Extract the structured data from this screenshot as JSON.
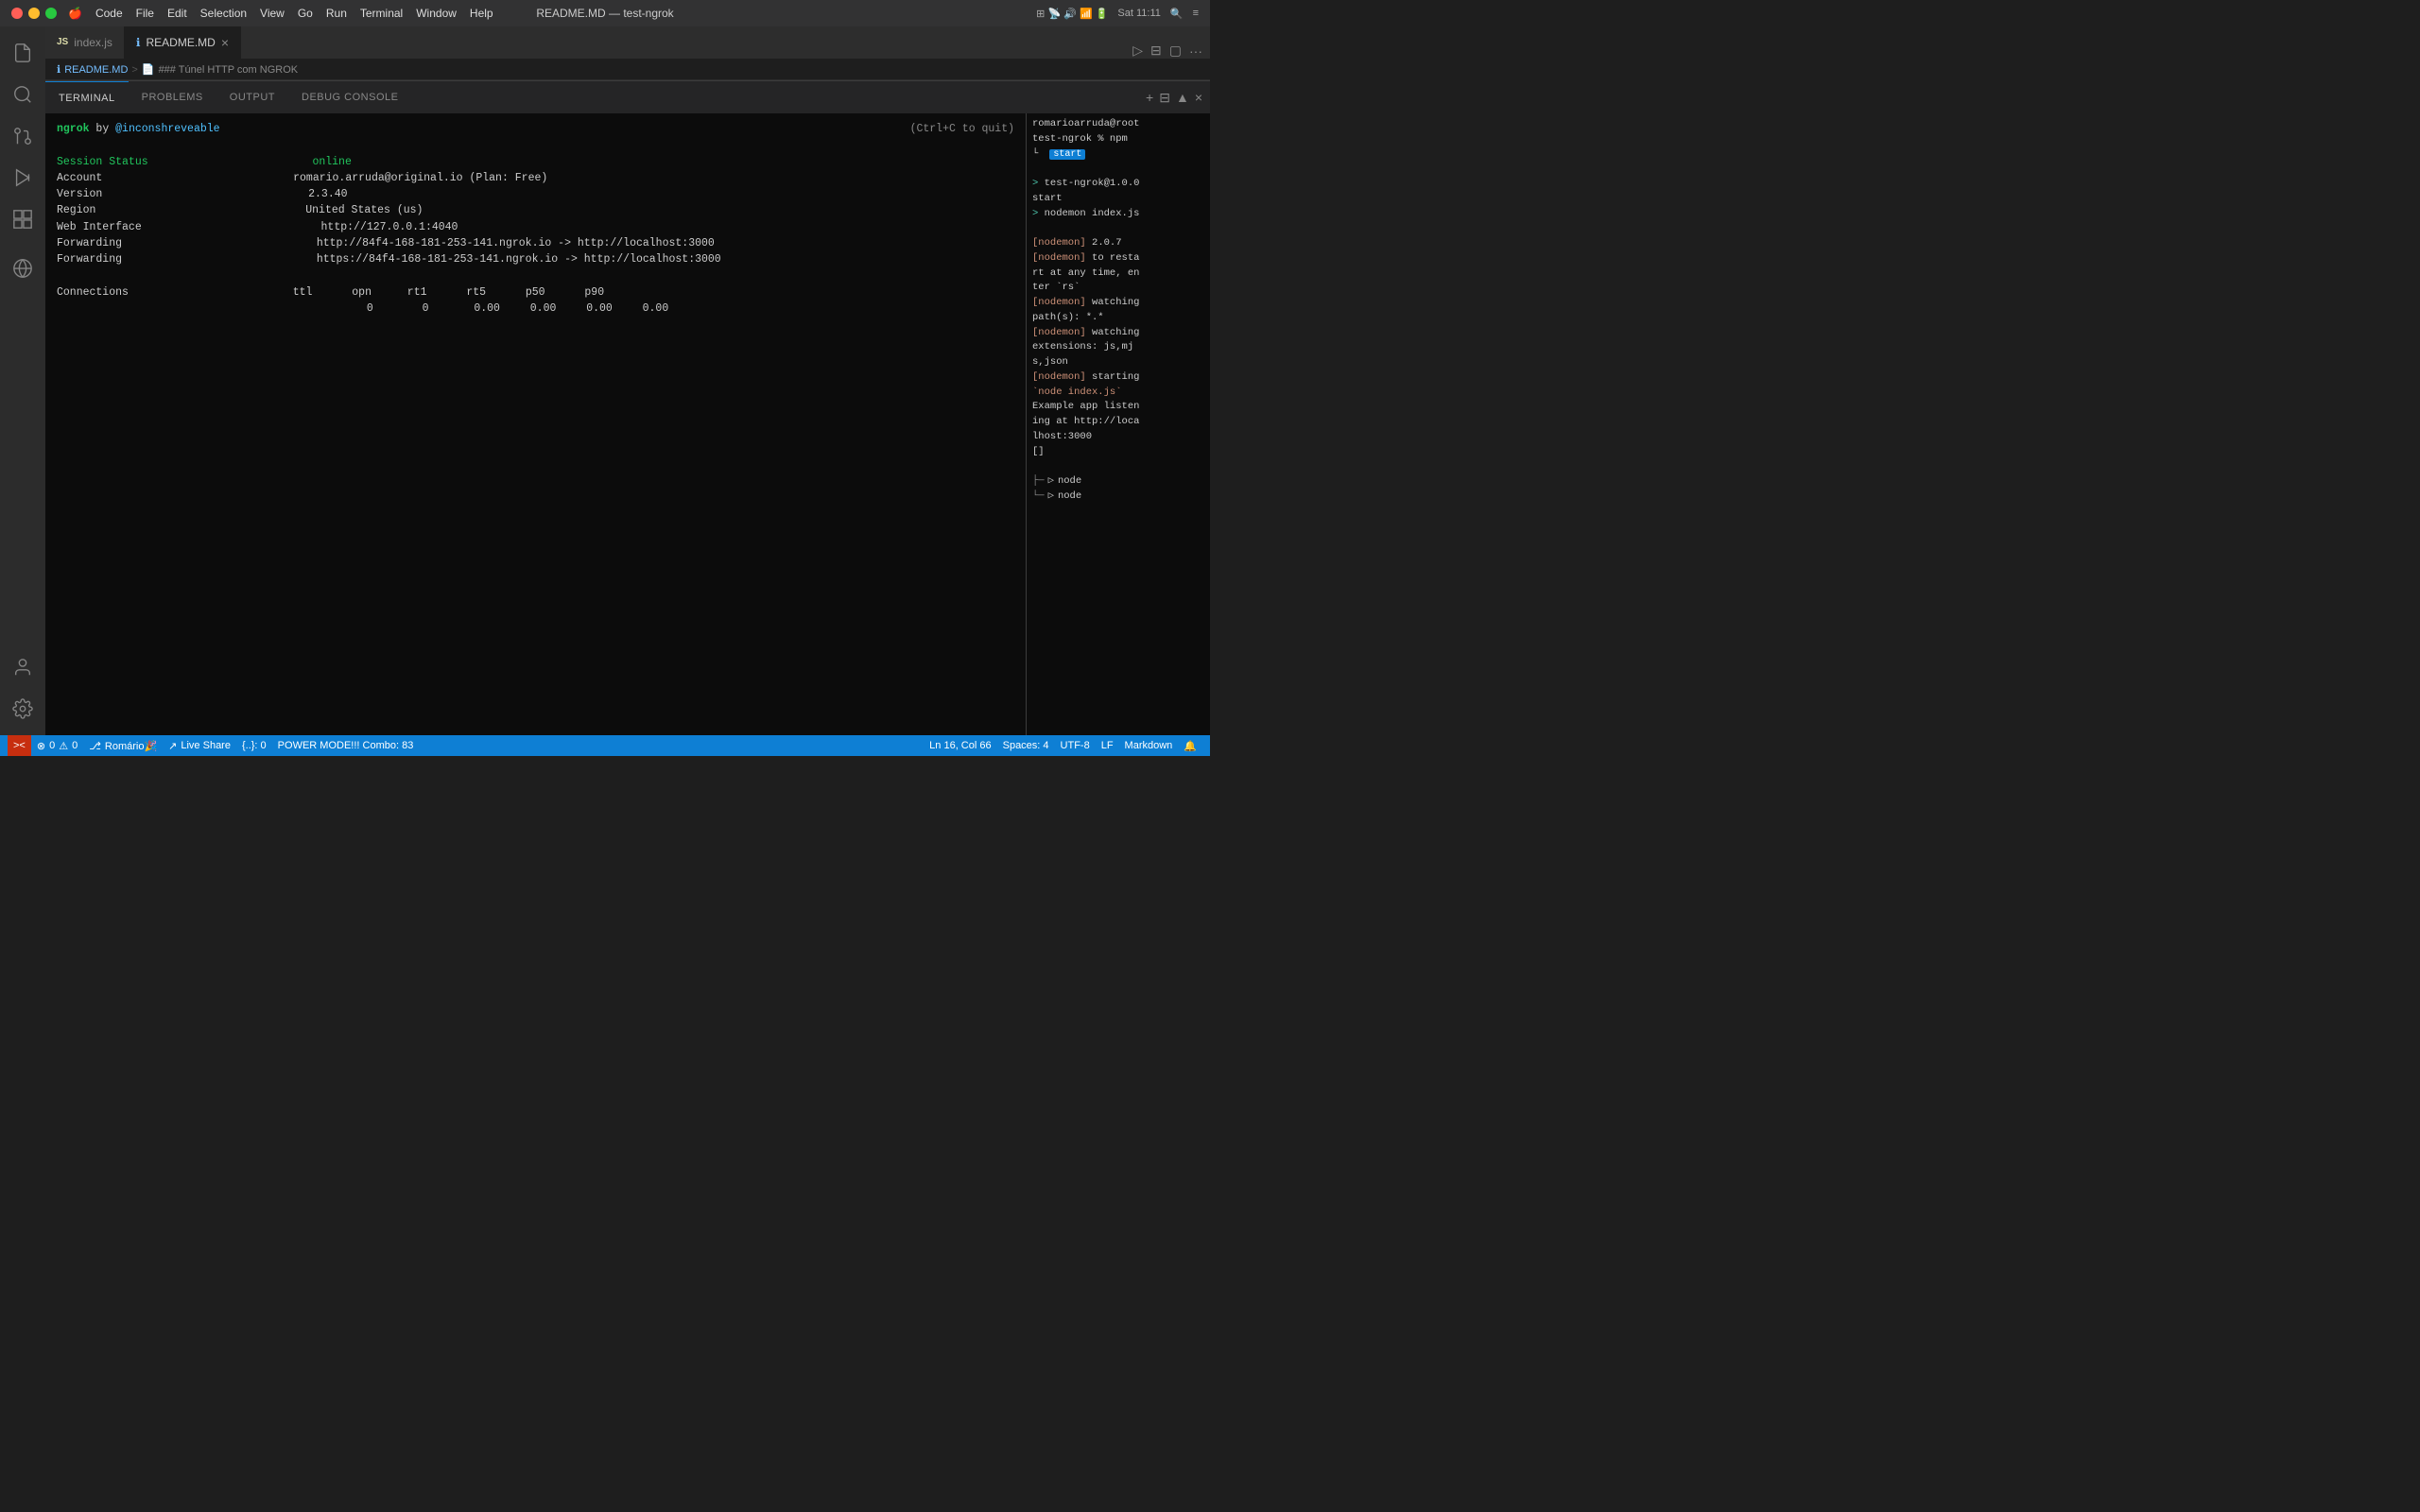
{
  "titleBar": {
    "title": "README.MD — test-ngrok",
    "menuItems": [
      "Code",
      "File",
      "Edit",
      "Selection",
      "View",
      "Go",
      "Run",
      "Terminal",
      "Window",
      "Help"
    ],
    "time": "Sat 11:11"
  },
  "tabs": [
    {
      "id": "index-js",
      "icon": "JS",
      "label": "index.js",
      "active": false,
      "modified": false
    },
    {
      "id": "readme-md",
      "icon": "ℹ",
      "label": "README.MD",
      "active": true,
      "modified": false
    }
  ],
  "breadcrumb": {
    "file": "README.MD",
    "separator": ">",
    "section": "### Túnel HTTP com NGROK"
  },
  "panelTabs": [
    "TERMINAL",
    "PROBLEMS",
    "OUTPUT",
    "DEBUG CONSOLE"
  ],
  "activePanelTab": "TERMINAL",
  "terminal": {
    "ngrokTitle": "ngrok",
    "ngrokBy": "by",
    "ngrokAuthor": "@inconshreveable",
    "ctrlC": "(Ctrl+C to quit)",
    "fields": [
      {
        "label": "Session Status",
        "value": "online",
        "valueColor": "green"
      },
      {
        "label": "Account",
        "value": "romario.arruda@original.io (Plan: Free)"
      },
      {
        "label": "Version",
        "value": "2.3.40"
      },
      {
        "label": "Region",
        "value": "United States (us)"
      },
      {
        "label": "Web Interface",
        "value": "http://127.0.0.1:4040"
      },
      {
        "label": "Forwarding",
        "value": "http://84f4-168-181-253-141.ngrok.io -> http://localhost:3000"
      },
      {
        "label": "Forwarding",
        "value": "https://84f4-168-181-253-141.ngrok.io -> http://localhost:3000"
      }
    ],
    "connections": {
      "label": "Connections",
      "headers": [
        "ttl",
        "opn",
        "rt1",
        "rt5",
        "p50",
        "p90"
      ],
      "values": [
        "0",
        "0",
        "0.00",
        "0.00",
        "0.00",
        "0.00"
      ]
    }
  },
  "terminalRight": {
    "line1": "romarioarruda@root",
    "line2": "test-ngrok % npm",
    "line3": "start",
    "line4": "",
    "line5": "> test-ngrok@1.0.0",
    "line6": "start",
    "line7": "> nodemon index.js",
    "line8": "",
    "line9": "[nodemon] 2.0.7",
    "line10": "[nodemon] to resta",
    "line11": "rt at any time, en",
    "line12": "ter `rs`",
    "line13": "[nodemon] watching",
    "line14": " path(s): *.*",
    "line15": "[nodemon] watching",
    "line16": " extensions: js,mj",
    "line17": "s,json",
    "line18": "[nodemon] starting",
    "line19": "`node index.js`",
    "line20": "Example app listen",
    "line21": "ing at http://loca",
    "line22": "lhost:3000",
    "line23": "[]",
    "treeNode1": "node",
    "treeNode2": "node"
  },
  "statusBar": {
    "gitBranch": "Romário🎉",
    "liveShare": "Live Share",
    "curlyBraces": "{..}: 0",
    "powerMode": "POWER MODE!!! Combo: 83",
    "errors": "0",
    "warnings": "0",
    "line": "Ln 16, Col 66",
    "spaces": "Spaces: 4",
    "encoding": "UTF-8",
    "lineEnding": "LF",
    "language": "Markdown"
  },
  "activityBar": {
    "icons": [
      {
        "id": "files",
        "symbol": "⎘",
        "active": false
      },
      {
        "id": "search",
        "symbol": "🔍",
        "active": false
      },
      {
        "id": "source-control",
        "symbol": "⎇",
        "active": false
      },
      {
        "id": "run",
        "symbol": "▷",
        "active": false
      },
      {
        "id": "extensions",
        "symbol": "⊞",
        "active": false
      },
      {
        "id": "remote",
        "symbol": "⟳",
        "active": false
      }
    ],
    "bottomIcons": [
      {
        "id": "account",
        "symbol": "👤"
      },
      {
        "id": "settings",
        "symbol": "⚙"
      }
    ]
  }
}
